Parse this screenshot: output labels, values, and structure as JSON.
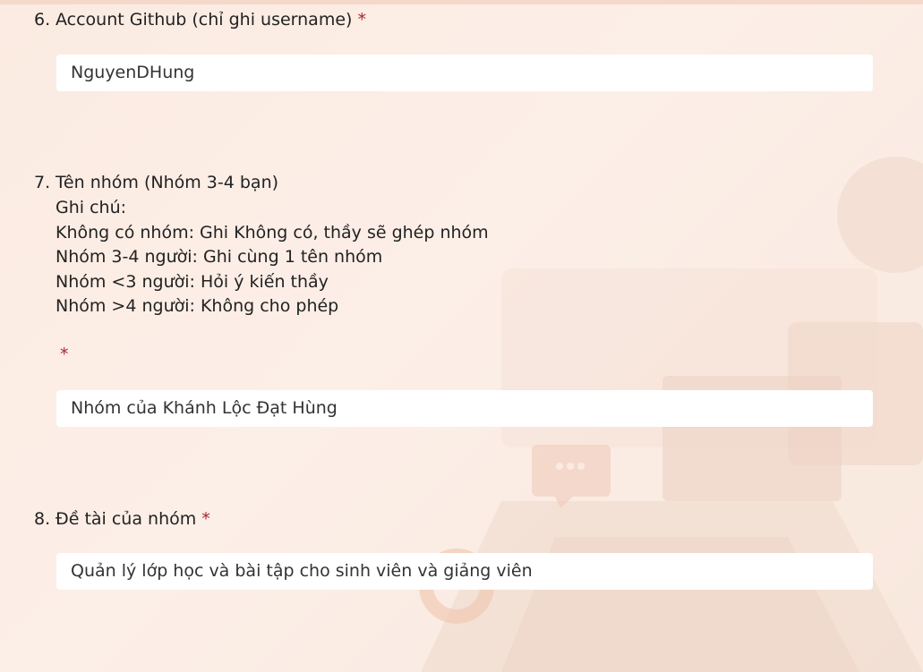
{
  "questions": [
    {
      "number": "6.",
      "title": "Account Github (chỉ ghi username)",
      "required": "*",
      "answer": "NguyenDHung"
    },
    {
      "number": "7.",
      "title": "Tên nhóm (Nhóm 3-4 bạn)",
      "notes": [
        "Ghi chú:",
        "Không có nhóm: Ghi Không có, thầy sẽ ghép nhóm",
        "Nhóm 3-4 người: Ghi cùng 1 tên nhóm",
        "Nhóm <3 người: Hỏi ý kiến thầy",
        "Nhóm >4 người: Không cho phép"
      ],
      "required": "*",
      "answer": "Nhóm của Khánh Lộc Đạt Hùng"
    },
    {
      "number": "8.",
      "title": "Đề tài của nhóm",
      "required": "*",
      "answer": "Quản lý lớp học và bài tập cho sinh viên và giảng viên"
    }
  ],
  "theme": {
    "background": "#fcefe7",
    "required_color": "#a4262c",
    "answer_background": "#ffffff"
  }
}
